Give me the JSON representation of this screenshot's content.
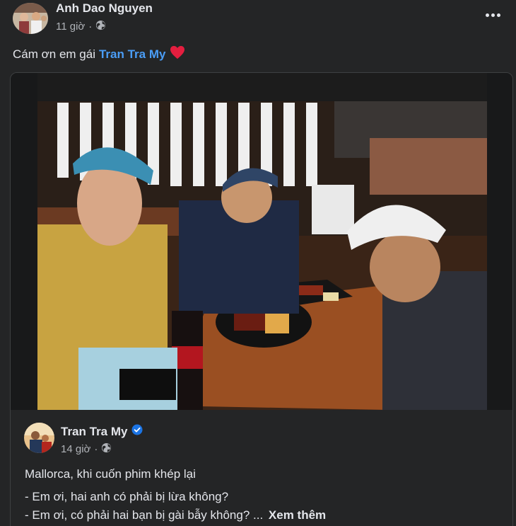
{
  "post": {
    "author": "Anh Dao Nguyen",
    "time": "11 giờ",
    "separator": "·",
    "privacy_icon": "globe-icon",
    "caption_prefix": "Cám ơn em gái",
    "mention": "Tran Tra My",
    "heart_icon": "heart-icon",
    "more_icon": "more-options-icon"
  },
  "shared_post": {
    "author": "Tran Tra My",
    "verified_icon": "verified-badge-icon",
    "time": "14 giờ",
    "separator": "·",
    "privacy_icon": "globe-icon",
    "text_line1": "Mallorca, khi cuốn phim khép lại",
    "text_line2": "- Em ơi, hai anh có phải bị lừa không?",
    "text_line3": "- Em ơi, có phải hai bạn bị gài bẫy không? ...",
    "see_more": "Xem thêm"
  },
  "colors": {
    "background": "#242526",
    "text_primary": "#e4e6eb",
    "text_secondary": "#b0b3b8",
    "link": "#4a9df6",
    "verified": "#1b74e4",
    "heart": "#e41e3f"
  }
}
